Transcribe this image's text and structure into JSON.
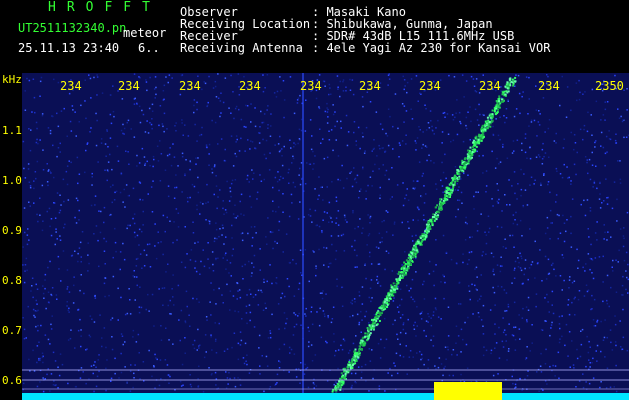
{
  "header": {
    "logo": "HROFFT",
    "filename": "UT2511132340.pn",
    "tag": "meteor",
    "datetime": "25.11.13 23:40",
    "count": "6..",
    "fields": [
      {
        "label": "Observer",
        "value": ": Masaki Kano"
      },
      {
        "label": "Receiving Location",
        "value": ": Shibukawa, Gunma, Japan"
      },
      {
        "label": "Receiver",
        "value": ": SDR# 43dB L15 111.6MHz USB"
      },
      {
        "label": "Receiving Antenna",
        "value": ": 4ele Yagi Az 230 for Kansai VOR"
      }
    ]
  },
  "axis": {
    "unit": "kHz",
    "freq_labels": [
      "1.1",
      "1.0",
      "0.9",
      "0.8",
      "0.7",
      "0.6"
    ],
    "time_labels": [
      "234",
      "234",
      "234",
      "234",
      "234",
      "234",
      "234",
      "234",
      "234",
      "2350"
    ]
  },
  "colors": {
    "background": "#000000",
    "noise": "#1a2aa8",
    "trail": "#33ff66",
    "baseline": "#00ffff",
    "burst": "#ffff00",
    "text_yellow": "#ffff00",
    "text_green": "#33ff33"
  }
}
